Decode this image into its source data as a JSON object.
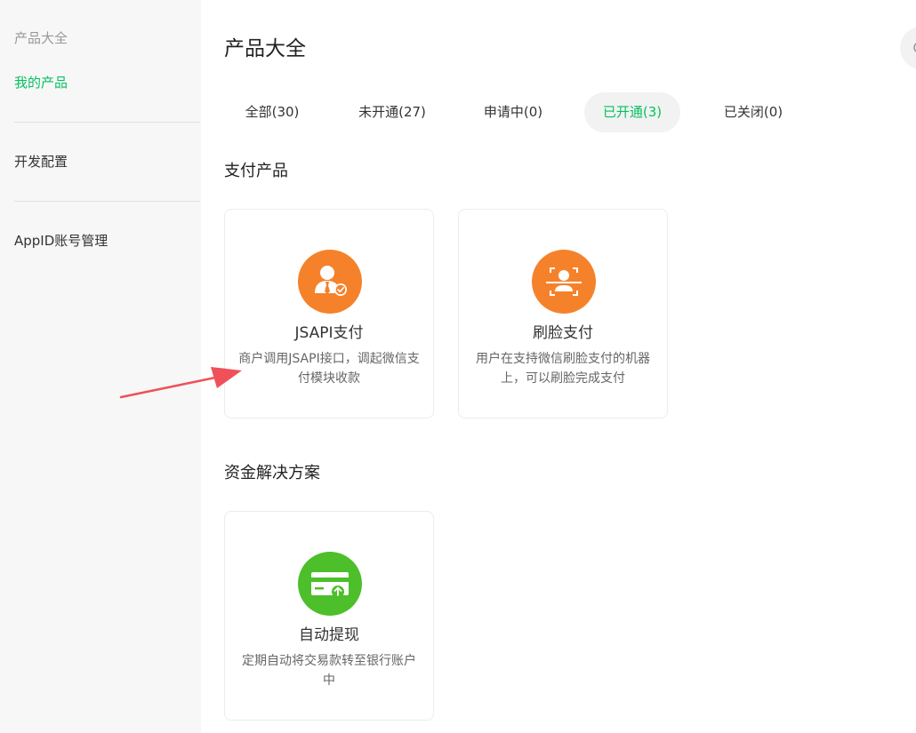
{
  "sidebar": {
    "items": [
      {
        "label": "产品大全"
      },
      {
        "label": "我的产品"
      },
      {
        "label": "开发配置"
      },
      {
        "label": "AppID账号管理"
      }
    ]
  },
  "main": {
    "title": "产品大全",
    "tabs": [
      {
        "label": "全部(30)"
      },
      {
        "label": "未开通(27)"
      },
      {
        "label": "申请中(0)"
      },
      {
        "label": "已开通(3)"
      },
      {
        "label": "已关闭(0)"
      }
    ],
    "active_tab": "已开通(3)",
    "sections": [
      {
        "title": "支付产品",
        "cards": [
          {
            "name": "JSAPI支付",
            "desc": "商户调用JSAPI接口，调起微信支付模块收款",
            "icon": "merchant-user-check-icon"
          },
          {
            "name": "刷脸支付",
            "desc": "用户在支持微信刷脸支付的机器上，可以刷脸完成支付",
            "icon": "face-scan-icon"
          }
        ]
      },
      {
        "title": "资金解决方案",
        "cards": [
          {
            "name": "自动提现",
            "desc": "定期自动将交易款转至银行账户中",
            "icon": "card-withdraw-icon"
          }
        ]
      }
    ]
  },
  "colors": {
    "accent": "#07c160",
    "orange_icon": "#f5822a",
    "green_icon": "#4cbf2a",
    "arrow": "#f0505a"
  }
}
